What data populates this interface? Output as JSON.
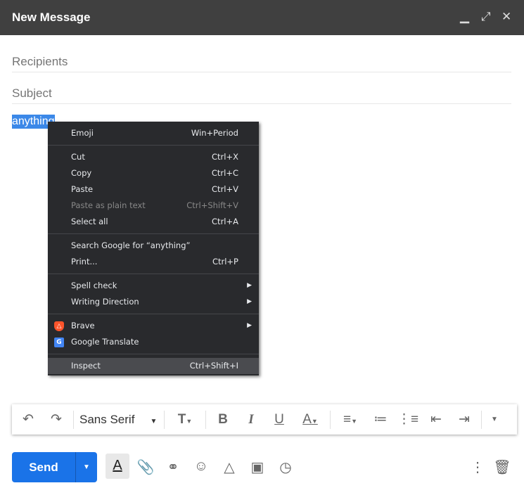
{
  "window": {
    "title": "New Message",
    "minimize_icon": "minimize-icon",
    "expand_icon": "expand-icon",
    "close_icon": "close-icon"
  },
  "fields": {
    "recipients_placeholder": "Recipients",
    "subject_placeholder": "Subject"
  },
  "body": {
    "selected_text": "anything"
  },
  "context_menu": {
    "emoji": {
      "label": "Emoji",
      "shortcut": "Win+Period"
    },
    "cut": {
      "label": "Cut",
      "shortcut": "Ctrl+X"
    },
    "copy": {
      "label": "Copy",
      "shortcut": "Ctrl+C"
    },
    "paste": {
      "label": "Paste",
      "shortcut": "Ctrl+V"
    },
    "paste_plain": {
      "label": "Paste as plain text",
      "shortcut": "Ctrl+Shift+V"
    },
    "select_all": {
      "label": "Select all",
      "shortcut": "Ctrl+A"
    },
    "search": {
      "label": "Search Google for “anything”"
    },
    "print": {
      "label": "Print...",
      "shortcut": "Ctrl+P"
    },
    "spell": {
      "label": "Spell check"
    },
    "writing": {
      "label": "Writing Direction"
    },
    "brave": {
      "label": "Brave"
    },
    "translate": {
      "label": "Google Translate"
    },
    "inspect": {
      "label": "Inspect",
      "shortcut": "Ctrl+Shift+I"
    }
  },
  "format_toolbar": {
    "font": "Sans Serif"
  },
  "actions": {
    "send_label": "Send"
  },
  "colors": {
    "accent": "#1a73e8",
    "header": "#404040",
    "menu_bg": "#292a2d",
    "selection": "#3b88e8"
  }
}
